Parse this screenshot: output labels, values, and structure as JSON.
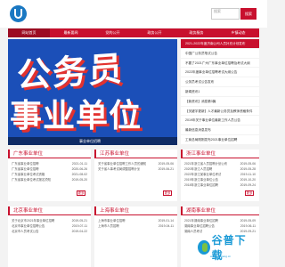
{
  "search": {
    "placeholder": "搜索",
    "button": "搜索"
  },
  "nav": [
    "网站首页",
    "最新要闻",
    "党的公开",
    "政务公开",
    "政务服务",
    "乡镇动态"
  ],
  "banner": {
    "line1": "公务员",
    "line2": "事业单位",
    "caption": "事业单位招聘"
  },
  "news": [
    "2021-2022年度济南公司人员补充计划发布",
    "中国广公务员笔试公告",
    "不要了2021广州广东事业单位招聘及考试大纲",
    "2022年度事业单位招聘考试大纲公告",
    "公务员考试公告发布",
    "新闻资讯1",
    "【新资讯】消息第3篇",
    "【关键字更新】人才最新公务员及教师资格条件",
    "2019年关于事业单位最新工作人员公告",
    "最新信息消息发布",
    "工商总局刚刚发布2021事业单位招聘",
    "中央人民政府关于公务员最新招聘信息"
  ],
  "boxes": [
    {
      "title": "广东事业单位",
      "rows": [
        [
          "广东省事业单位招聘",
          "2021-01-11"
        ],
        [
          "广东省事业单位招聘",
          "2020-06-26"
        ],
        [
          "广东省事业单位考试资格",
          "2021-08-02"
        ],
        [
          "广东省事业单位考试报名须知",
          "2019-05-20"
        ]
      ],
      "more": "更多"
    },
    {
      "title": "江苏事业单位",
      "rows": [
        [
          "关于省事业单位招聘工作人员的通知",
          "2019-05-06"
        ],
        [
          "关于省人事考试局调整招聘计划",
          "2019-06-21"
        ]
      ],
      "more": "更多"
    },
    {
      "title": "浙江事业单位",
      "rows": [
        [
          "2021年浙江省人员招聘计划公布",
          "2019-05-06"
        ],
        [
          "2020年浙江人员招聘",
          "2019-05-28"
        ],
        [
          "2022年浙江某事业单位考试",
          "2019-11-10"
        ],
        [
          "2019年浙江事业单位公告",
          "2019-10-20"
        ],
        [
          "2018年浙江事业单位招聘",
          "2019-09-24"
        ],
        [
          "2018年浙江事业单位考试",
          "2019-05-06"
        ],
        [
          "浙江人员招聘信息",
          "2019-05-11"
        ]
      ],
      "more": "更多"
    },
    {
      "title": "北京事业单位",
      "rows": [
        [
          "关于北京市2021年事业单位招聘",
          "2019-05-21"
        ],
        [
          "北京市事业单位招聘公告",
          "2019-07-11"
        ],
        [
          "北京市人员考试公告",
          "2019-04-22"
        ]
      ],
      "more": ""
    },
    {
      "title": "上海事业单位",
      "rows": [
        [
          "上海市事业单位招聘",
          "2019-01-14"
        ],
        [
          "上海市人员招聘",
          "2019-04-11"
        ]
      ],
      "more": ""
    },
    {
      "title": "湖南事业单位",
      "rows": [
        [
          "2021年湖南事业单位招聘",
          "2019-05-09"
        ],
        [
          "湖南事业单位招聘公告",
          "2019-06-11"
        ],
        [
          "湖南人员考试",
          "2019-09-21"
        ],
        [
          "湖南省考试公告",
          "2019-01-11"
        ],
        [
          "湖南省招聘",
          "2019-11-02"
        ]
      ],
      "more": ""
    }
  ],
  "watermark": {
    "text": "谷普下载",
    "sub": "www.sobijiang.cn"
  }
}
